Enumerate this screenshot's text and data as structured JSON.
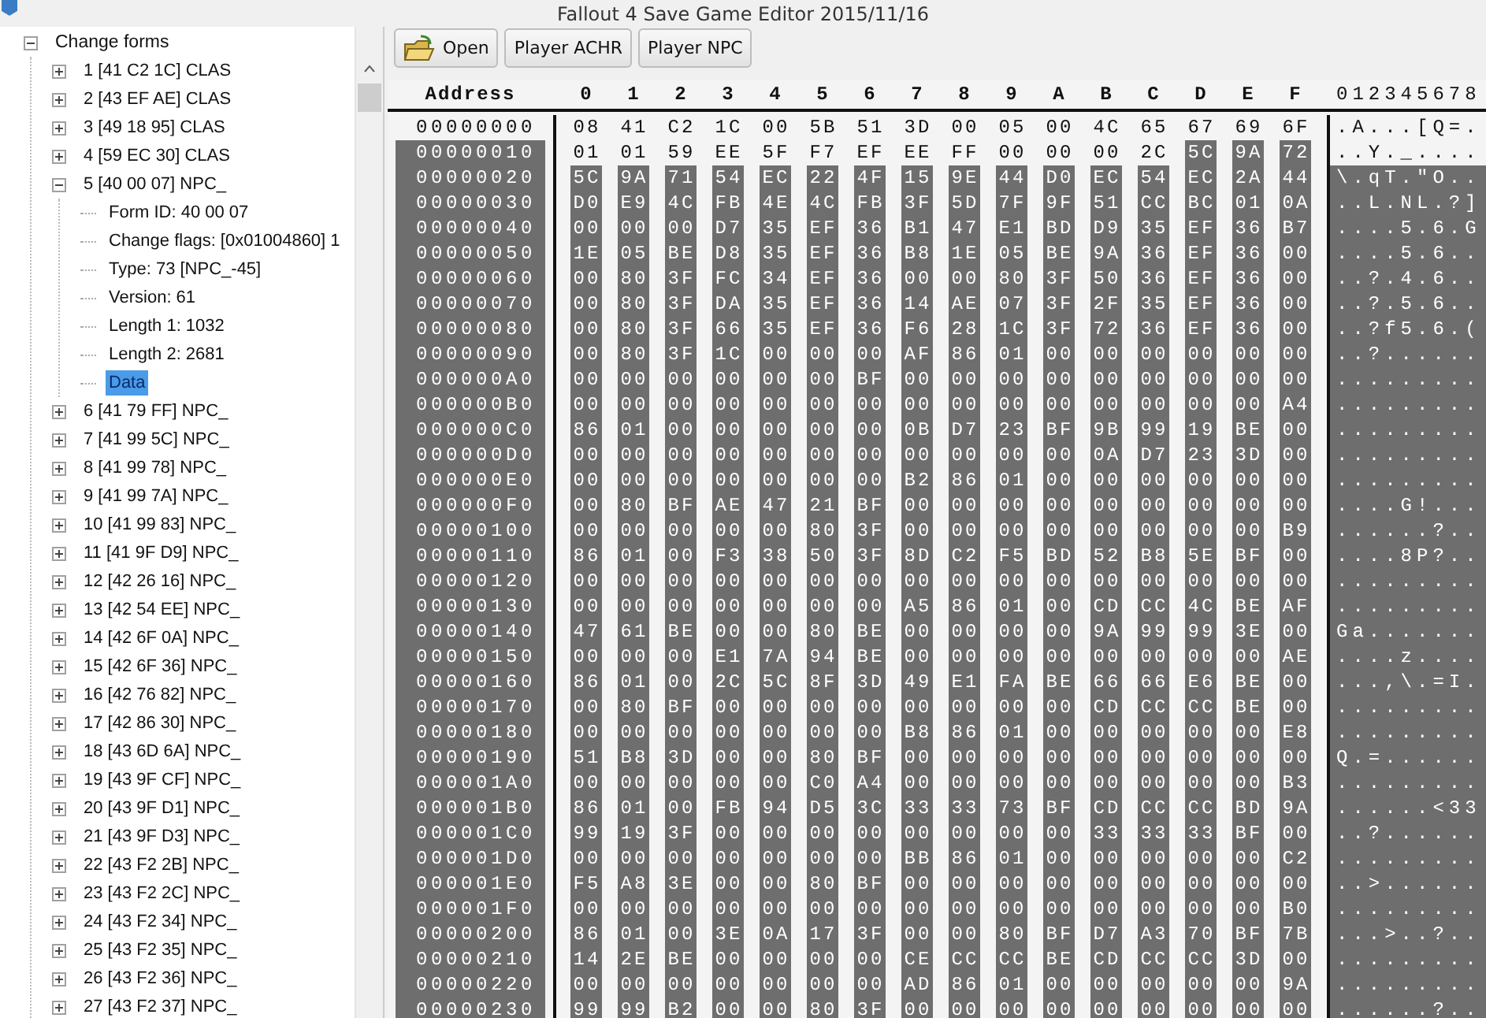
{
  "window": {
    "title": "Fallout 4 Save Game Editor 2015/11/16"
  },
  "tree": {
    "label": "Change forms",
    "expanded": true,
    "selected": false,
    "children": [
      {
        "label": "1 [41 C2 1C] CLAS",
        "expanded": false,
        "selected": false
      },
      {
        "label": "2 [43 EF AE] CLAS",
        "expanded": false,
        "selected": false
      },
      {
        "label": "3 [49 18 95] CLAS",
        "expanded": false,
        "selected": false
      },
      {
        "label": "4 [59 EC 30] CLAS",
        "expanded": false,
        "selected": false
      },
      {
        "label": "5 [40 00 07] NPC_",
        "expanded": true,
        "selected": false,
        "children": [
          {
            "label": "Form ID: 40 00 07",
            "selected": false
          },
          {
            "label": "Change flags: [0x01004860] 1",
            "selected": false
          },
          {
            "label": "Type: 73 [NPC_-45]",
            "selected": false
          },
          {
            "label": "Version: 61",
            "selected": false
          },
          {
            "label": "Length 1: 1032",
            "selected": false
          },
          {
            "label": "Length 2: 2681",
            "selected": false
          },
          {
            "label": "Data",
            "selected": true
          }
        ]
      },
      {
        "label": "6 [41 79 FF] NPC_",
        "expanded": false,
        "selected": false
      },
      {
        "label": "7 [41 99 5C] NPC_",
        "expanded": false,
        "selected": false
      },
      {
        "label": "8 [41 99 78] NPC_",
        "expanded": false,
        "selected": false
      },
      {
        "label": "9 [41 99 7A] NPC_",
        "expanded": false,
        "selected": false
      },
      {
        "label": "10 [41 99 83] NPC_",
        "expanded": false,
        "selected": false
      },
      {
        "label": "11 [41 9F D9] NPC_",
        "expanded": false,
        "selected": false
      },
      {
        "label": "12 [42 26 16] NPC_",
        "expanded": false,
        "selected": false
      },
      {
        "label": "13 [42 54 EE] NPC_",
        "expanded": false,
        "selected": false
      },
      {
        "label": "14 [42 6F 0A] NPC_",
        "expanded": false,
        "selected": false
      },
      {
        "label": "15 [42 6F 36] NPC_",
        "expanded": false,
        "selected": false
      },
      {
        "label": "16 [42 76 82] NPC_",
        "expanded": false,
        "selected": false
      },
      {
        "label": "17 [42 86 30] NPC_",
        "expanded": false,
        "selected": false
      },
      {
        "label": "18 [43 6D 6A] NPC_",
        "expanded": false,
        "selected": false
      },
      {
        "label": "19 [43 9F CF] NPC_",
        "expanded": false,
        "selected": false
      },
      {
        "label": "20 [43 9F D1] NPC_",
        "expanded": false,
        "selected": false
      },
      {
        "label": "21 [43 9F D3] NPC_",
        "expanded": false,
        "selected": false
      },
      {
        "label": "22 [43 F2 2B] NPC_",
        "expanded": false,
        "selected": false
      },
      {
        "label": "23 [43 F2 2C] NPC_",
        "expanded": false,
        "selected": false
      },
      {
        "label": "24 [43 F2 34] NPC_",
        "expanded": false,
        "selected": false
      },
      {
        "label": "25 [43 F2 35] NPC_",
        "expanded": false,
        "selected": false
      },
      {
        "label": "26 [43 F2 36] NPC_",
        "expanded": false,
        "selected": false
      },
      {
        "label": "27 [43 F2 37] NPC_",
        "expanded": false,
        "selected": false
      }
    ]
  },
  "toolbar": [
    {
      "label": "Open",
      "kind": "icon"
    },
    {
      "label": "Player ACHR",
      "kind": "text"
    },
    {
      "label": "Player NPC",
      "kind": "text"
    }
  ],
  "hex": {
    "address_header": "Address",
    "columns": [
      "0",
      "1",
      "2",
      "3",
      "4",
      "5",
      "6",
      "7",
      "8",
      "9",
      "A",
      "B",
      "C",
      "D",
      "E",
      "F"
    ],
    "ascii_header": "012345678",
    "rows": [
      {
        "address": "00000000",
        "bytes": [
          "08",
          "41",
          "C2",
          "1C",
          "00",
          "5B",
          "51",
          "3D",
          "00",
          "05",
          "00",
          "4C",
          "65",
          "67",
          "69",
          "6F"
        ],
        "ascii": ".A...[Q=.",
        "selected": false
      },
      {
        "address": "00000010",
        "bytes": [
          "01",
          "01",
          "59",
          "EE",
          "5F",
          "F7",
          "EF",
          "EE",
          "FF",
          "00",
          "00",
          "00",
          "2C",
          "5C",
          "9A",
          "72"
        ],
        "ascii": "..Y._....",
        "selected": true,
        "bytes_selected": [
          false,
          false,
          false,
          false,
          false,
          false,
          false,
          false,
          false,
          false,
          false,
          false,
          false,
          true,
          true,
          true
        ]
      },
      {
        "address": "00000020",
        "bytes": [
          "5C",
          "9A",
          "71",
          "54",
          "EC",
          "22",
          "4F",
          "15",
          "9E",
          "44",
          "D0",
          "EC",
          "54",
          "EC",
          "2A",
          "44"
        ],
        "ascii": "\\.qT.\"O..",
        "selected": true
      },
      {
        "address": "00000030",
        "bytes": [
          "D0",
          "E9",
          "4C",
          "FB",
          "4E",
          "4C",
          "FB",
          "3F",
          "5D",
          "7F",
          "9F",
          "51",
          "CC",
          "BC",
          "01",
          "0A"
        ],
        "ascii": "..L.NL.?]",
        "selected": true
      },
      {
        "address": "00000040",
        "bytes": [
          "00",
          "00",
          "00",
          "D7",
          "35",
          "EF",
          "36",
          "B1",
          "47",
          "E1",
          "BD",
          "D9",
          "35",
          "EF",
          "36",
          "B7"
        ],
        "ascii": "....5.6.G",
        "selected": true
      },
      {
        "address": "00000050",
        "bytes": [
          "1E",
          "05",
          "BE",
          "D8",
          "35",
          "EF",
          "36",
          "B8",
          "1E",
          "05",
          "BE",
          "9A",
          "36",
          "EF",
          "36",
          "00"
        ],
        "ascii": "....5.6..",
        "selected": true
      },
      {
        "address": "00000060",
        "bytes": [
          "00",
          "80",
          "3F",
          "FC",
          "34",
          "EF",
          "36",
          "00",
          "00",
          "80",
          "3F",
          "50",
          "36",
          "EF",
          "36",
          "00"
        ],
        "ascii": "..?.4.6..",
        "selected": true
      },
      {
        "address": "00000070",
        "bytes": [
          "00",
          "80",
          "3F",
          "DA",
          "35",
          "EF",
          "36",
          "14",
          "AE",
          "07",
          "3F",
          "2F",
          "35",
          "EF",
          "36",
          "00"
        ],
        "ascii": "..?.5.6..",
        "selected": true
      },
      {
        "address": "00000080",
        "bytes": [
          "00",
          "80",
          "3F",
          "66",
          "35",
          "EF",
          "36",
          "F6",
          "28",
          "1C",
          "3F",
          "72",
          "36",
          "EF",
          "36",
          "00"
        ],
        "ascii": "..?f5.6.(",
        "selected": true
      },
      {
        "address": "00000090",
        "bytes": [
          "00",
          "80",
          "3F",
          "1C",
          "00",
          "00",
          "00",
          "AF",
          "86",
          "01",
          "00",
          "00",
          "00",
          "00",
          "00",
          "00"
        ],
        "ascii": "..?......",
        "selected": true
      },
      {
        "address": "000000A0",
        "bytes": [
          "00",
          "00",
          "00",
          "00",
          "00",
          "00",
          "BF",
          "00",
          "00",
          "00",
          "00",
          "00",
          "00",
          "00",
          "00",
          "00"
        ],
        "ascii": ".........",
        "selected": true
      },
      {
        "address": "000000B0",
        "bytes": [
          "00",
          "00",
          "00",
          "00",
          "00",
          "00",
          "00",
          "00",
          "00",
          "00",
          "00",
          "00",
          "00",
          "00",
          "00",
          "A4"
        ],
        "ascii": ".........",
        "selected": true
      },
      {
        "address": "000000C0",
        "bytes": [
          "86",
          "01",
          "00",
          "00",
          "00",
          "00",
          "00",
          "0B",
          "D7",
          "23",
          "BF",
          "9B",
          "99",
          "19",
          "BE",
          "00"
        ],
        "ascii": ".........",
        "selected": true
      },
      {
        "address": "000000D0",
        "bytes": [
          "00",
          "00",
          "00",
          "00",
          "00",
          "00",
          "00",
          "00",
          "00",
          "00",
          "00",
          "0A",
          "D7",
          "23",
          "3D",
          "00"
        ],
        "ascii": ".........",
        "selected": true
      },
      {
        "address": "000000E0",
        "bytes": [
          "00",
          "00",
          "00",
          "00",
          "00",
          "00",
          "00",
          "B2",
          "86",
          "01",
          "00",
          "00",
          "00",
          "00",
          "00",
          "00"
        ],
        "ascii": ".........",
        "selected": true
      },
      {
        "address": "000000F0",
        "bytes": [
          "00",
          "80",
          "BF",
          "AE",
          "47",
          "21",
          "BF",
          "00",
          "00",
          "00",
          "00",
          "00",
          "00",
          "00",
          "00",
          "00"
        ],
        "ascii": "....G!...",
        "selected": true
      },
      {
        "address": "00000100",
        "bytes": [
          "00",
          "00",
          "00",
          "00",
          "00",
          "80",
          "3F",
          "00",
          "00",
          "00",
          "00",
          "00",
          "00",
          "00",
          "00",
          "B9"
        ],
        "ascii": "......?..",
        "selected": true
      },
      {
        "address": "00000110",
        "bytes": [
          "86",
          "01",
          "00",
          "F3",
          "38",
          "50",
          "3F",
          "8D",
          "C2",
          "F5",
          "BD",
          "52",
          "B8",
          "5E",
          "BF",
          "00"
        ],
        "ascii": "....8P?..",
        "selected": true
      },
      {
        "address": "00000120",
        "bytes": [
          "00",
          "00",
          "00",
          "00",
          "00",
          "00",
          "00",
          "00",
          "00",
          "00",
          "00",
          "00",
          "00",
          "00",
          "00",
          "00"
        ],
        "ascii": ".........",
        "selected": true
      },
      {
        "address": "00000130",
        "bytes": [
          "00",
          "00",
          "00",
          "00",
          "00",
          "00",
          "00",
          "A5",
          "86",
          "01",
          "00",
          "CD",
          "CC",
          "4C",
          "BE",
          "AF"
        ],
        "ascii": ".........",
        "selected": true
      },
      {
        "address": "00000140",
        "bytes": [
          "47",
          "61",
          "BE",
          "00",
          "00",
          "80",
          "BE",
          "00",
          "00",
          "00",
          "00",
          "9A",
          "99",
          "99",
          "3E",
          "00"
        ],
        "ascii": "Ga.......",
        "selected": true
      },
      {
        "address": "00000150",
        "bytes": [
          "00",
          "00",
          "00",
          "E1",
          "7A",
          "94",
          "BE",
          "00",
          "00",
          "00",
          "00",
          "00",
          "00",
          "00",
          "00",
          "AE"
        ],
        "ascii": "....z....",
        "selected": true
      },
      {
        "address": "00000160",
        "bytes": [
          "86",
          "01",
          "00",
          "2C",
          "5C",
          "8F",
          "3D",
          "49",
          "E1",
          "FA",
          "BE",
          "66",
          "66",
          "E6",
          "BE",
          "00"
        ],
        "ascii": "...,\\.=I.",
        "selected": true
      },
      {
        "address": "00000170",
        "bytes": [
          "00",
          "80",
          "BF",
          "00",
          "00",
          "00",
          "00",
          "00",
          "00",
          "00",
          "00",
          "CD",
          "CC",
          "CC",
          "BE",
          "00"
        ],
        "ascii": ".........",
        "selected": true
      },
      {
        "address": "00000180",
        "bytes": [
          "00",
          "00",
          "00",
          "00",
          "00",
          "00",
          "00",
          "B8",
          "86",
          "01",
          "00",
          "00",
          "00",
          "00",
          "00",
          "E8"
        ],
        "ascii": ".........",
        "selected": true
      },
      {
        "address": "00000190",
        "bytes": [
          "51",
          "B8",
          "3D",
          "00",
          "00",
          "80",
          "BF",
          "00",
          "00",
          "00",
          "00",
          "00",
          "00",
          "00",
          "00",
          "00"
        ],
        "ascii": "Q.=......",
        "selected": true
      },
      {
        "address": "000001A0",
        "bytes": [
          "00",
          "00",
          "00",
          "00",
          "00",
          "C0",
          "A4",
          "00",
          "00",
          "00",
          "00",
          "00",
          "00",
          "00",
          "00",
          "B3"
        ],
        "ascii": ".........",
        "selected": true
      },
      {
        "address": "000001B0",
        "bytes": [
          "86",
          "01",
          "00",
          "FB",
          "94",
          "D5",
          "3C",
          "33",
          "33",
          "73",
          "BF",
          "CD",
          "CC",
          "CC",
          "BD",
          "9A"
        ],
        "ascii": "......<33",
        "selected": true
      },
      {
        "address": "000001C0",
        "bytes": [
          "99",
          "19",
          "3F",
          "00",
          "00",
          "00",
          "00",
          "00",
          "00",
          "00",
          "00",
          "33",
          "33",
          "33",
          "BF",
          "00"
        ],
        "ascii": "..?......",
        "selected": true
      },
      {
        "address": "000001D0",
        "bytes": [
          "00",
          "00",
          "00",
          "00",
          "00",
          "00",
          "00",
          "BB",
          "86",
          "01",
          "00",
          "00",
          "00",
          "00",
          "00",
          "C2"
        ],
        "ascii": ".........",
        "selected": true
      },
      {
        "address": "000001E0",
        "bytes": [
          "F5",
          "A8",
          "3E",
          "00",
          "00",
          "80",
          "BF",
          "00",
          "00",
          "00",
          "00",
          "00",
          "00",
          "00",
          "00",
          "00"
        ],
        "ascii": "..>......",
        "selected": true
      },
      {
        "address": "000001F0",
        "bytes": [
          "00",
          "00",
          "00",
          "00",
          "00",
          "00",
          "00",
          "00",
          "00",
          "00",
          "00",
          "00",
          "00",
          "00",
          "00",
          "B0"
        ],
        "ascii": ".........",
        "selected": true
      },
      {
        "address": "00000200",
        "bytes": [
          "86",
          "01",
          "00",
          "3E",
          "0A",
          "17",
          "3F",
          "00",
          "00",
          "80",
          "BF",
          "D7",
          "A3",
          "70",
          "BF",
          "7B"
        ],
        "ascii": "...>..?..",
        "selected": true
      },
      {
        "address": "00000210",
        "bytes": [
          "14",
          "2E",
          "BE",
          "00",
          "00",
          "00",
          "00",
          "CE",
          "CC",
          "CC",
          "BE",
          "CD",
          "CC",
          "CC",
          "3D",
          "00"
        ],
        "ascii": ".........",
        "selected": true
      },
      {
        "address": "00000220",
        "bytes": [
          "00",
          "00",
          "00",
          "00",
          "00",
          "00",
          "00",
          "AD",
          "86",
          "01",
          "00",
          "00",
          "00",
          "00",
          "00",
          "9A"
        ],
        "ascii": ".........",
        "selected": true
      },
      {
        "address": "00000230",
        "bytes": [
          "99",
          "99",
          "B2",
          "00",
          "00",
          "80",
          "3F",
          "00",
          "00",
          "00",
          "00",
          "00",
          "00",
          "00",
          "00",
          "00"
        ],
        "ascii": "......?..",
        "selected": true
      }
    ]
  }
}
